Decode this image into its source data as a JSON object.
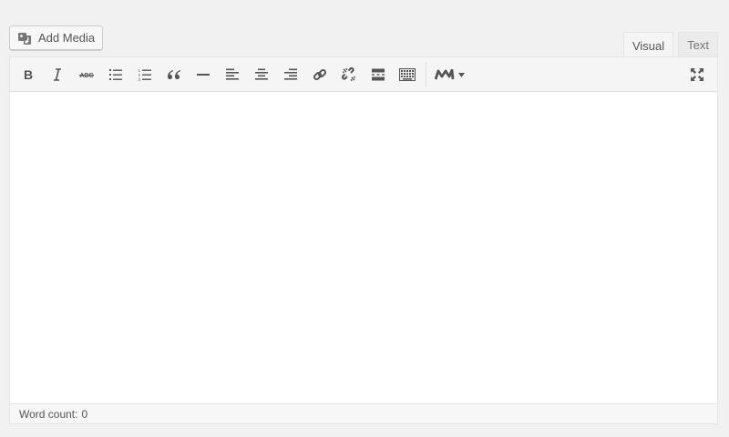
{
  "media_button": {
    "label": "Add Media",
    "icon": "media-icon"
  },
  "tabs": [
    {
      "label": "Visual",
      "active": true
    },
    {
      "label": "Text",
      "active": false
    }
  ],
  "toolbar": {
    "buttons": [
      {
        "name": "bold",
        "icon": "bold-icon"
      },
      {
        "name": "italic",
        "icon": "italic-icon"
      },
      {
        "name": "strikethrough",
        "icon": "strikethrough-icon"
      },
      {
        "name": "bulleted-list",
        "icon": "bulleted-list-icon"
      },
      {
        "name": "numbered-list",
        "icon": "numbered-list-icon"
      },
      {
        "name": "blockquote",
        "icon": "blockquote-icon"
      },
      {
        "name": "horizontal-line",
        "icon": "horizontal-line-icon"
      },
      {
        "name": "align-left",
        "icon": "align-left-icon"
      },
      {
        "name": "align-center",
        "icon": "align-center-icon"
      },
      {
        "name": "align-right",
        "icon": "align-right-icon"
      },
      {
        "name": "insert-link",
        "icon": "link-icon"
      },
      {
        "name": "remove-link",
        "icon": "unlink-icon"
      },
      {
        "name": "read-more",
        "icon": "read-more-icon"
      },
      {
        "name": "toolbar-toggle",
        "icon": "keyboard-icon"
      },
      {
        "name": "plugin-menu",
        "icon": "m-logo-dropdown-icon"
      },
      {
        "name": "fullscreen",
        "icon": "fullscreen-icon"
      }
    ]
  },
  "status": {
    "word_count_label": "Word count:",
    "word_count": "0"
  },
  "colors": {
    "background": "#f1f1f1",
    "toolbar": "#f5f5f5",
    "icon": "#555555"
  }
}
